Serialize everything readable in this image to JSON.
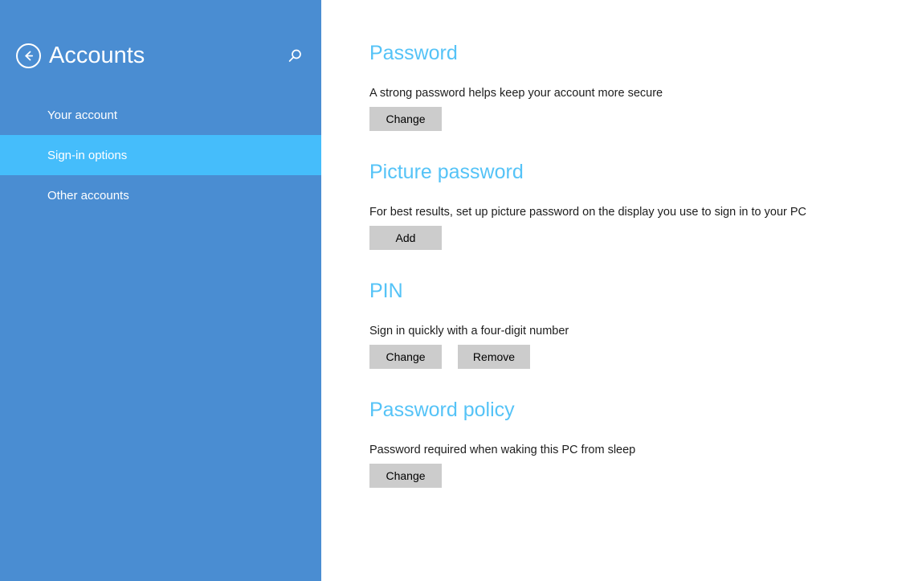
{
  "sidebar": {
    "back_icon": "back-arrow-icon",
    "title": "Accounts",
    "search_icon": "search-icon",
    "items": [
      {
        "label": "Your account",
        "selected": false
      },
      {
        "label": "Sign-in options",
        "selected": true
      },
      {
        "label": "Other accounts",
        "selected": false
      }
    ]
  },
  "colors": {
    "sidebar_bg": "#4a8dd2",
    "sidebar_selected": "#45bdfb",
    "heading": "#55c3f7",
    "button_bg": "#cccccc",
    "content_bg": "#ffffff",
    "body_text": "#1d1d1d"
  },
  "main": {
    "sections": [
      {
        "heading": "Password",
        "description": "A strong password helps keep your account more secure",
        "buttons": [
          "Change"
        ]
      },
      {
        "heading": "Picture password",
        "description": "For best results, set up picture password on the display you use to sign in to your PC",
        "buttons": [
          "Add"
        ]
      },
      {
        "heading": "PIN",
        "description": "Sign in quickly with a four-digit number",
        "buttons": [
          "Change",
          "Remove"
        ]
      },
      {
        "heading": "Password policy",
        "description": "Password required when waking this PC from sleep",
        "buttons": [
          "Change"
        ]
      }
    ]
  }
}
